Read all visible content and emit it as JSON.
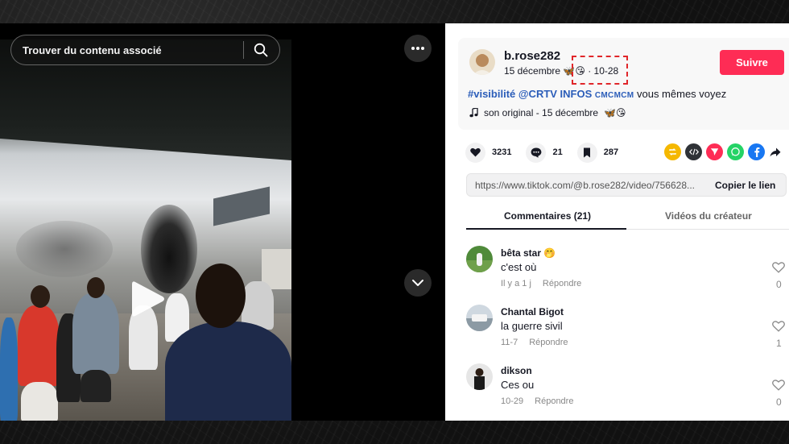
{
  "video": {
    "search_placeholder": "Trouver du contenu associé"
  },
  "post": {
    "username": "b.rose282",
    "date": "15 décembre",
    "date_emoji": "🦋😘",
    "date_suffix": "· 10-28",
    "follow_label": "Suivre",
    "caption_hashtag": "#visibilité",
    "caption_mention": "@CRTV INFOS",
    "caption_small": "CMCMCM",
    "caption_text": " vous mêmes voyez",
    "music": "son original - 15 décembre",
    "music_emoji": "🦋😘"
  },
  "stats": {
    "likes": "3231",
    "comments": "21",
    "saves": "287"
  },
  "share": {
    "link": "https://www.tiktok.com/@b.rose282/video/756628...",
    "copy_label": "Copier le lien"
  },
  "tabs": {
    "comments": "Commentaires (21)",
    "creator_videos": "Vidéos du créateur"
  },
  "comments": [
    {
      "name": "bêta star",
      "name_emoji": "🤭",
      "text": "c'est où",
      "time": "Il y a 1 j",
      "reply": "Répondre",
      "likes": "0"
    },
    {
      "name": "Chantal Bigot",
      "name_emoji": "",
      "text": "la guerre sivil",
      "time": "11-7",
      "reply": "Répondre",
      "likes": "1"
    },
    {
      "name": "dikson",
      "name_emoji": "",
      "text": "Ces ou",
      "time": "10-29",
      "reply": "Répondre",
      "likes": "0"
    }
  ],
  "colors": {
    "accent": "#fe2c55",
    "highlight_box": "#e0262a",
    "hashtag": "#2b5db9"
  }
}
